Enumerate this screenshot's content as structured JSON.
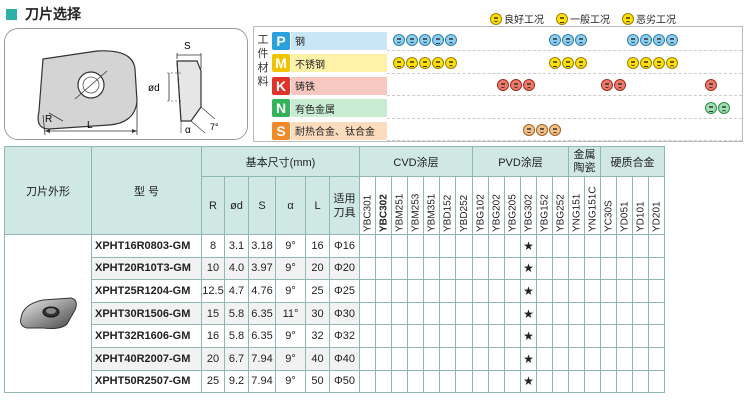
{
  "title": "刀片选择",
  "legend": [
    {
      "label": "良好工况",
      "kind": "good"
    },
    {
      "label": "一般工况",
      "kind": "mid"
    },
    {
      "label": "恶劣工况",
      "kind": "bad"
    }
  ],
  "diagram_labels": {
    "S": "S",
    "phi_d": "ød",
    "R": "R",
    "L": "L",
    "alpha": "α",
    "angle": "7°"
  },
  "wm_label": "工件材料",
  "materials": [
    {
      "code": "P",
      "name": "钢",
      "badge_color": "#2aa0dc",
      "name_bg": "#c8e6f6",
      "face_color": "blue",
      "faces": [
        [
          6,
          "good"
        ],
        [
          19,
          "good"
        ],
        [
          32,
          "good"
        ],
        [
          45,
          "mid"
        ],
        [
          58,
          "bad"
        ],
        [
          162,
          "good"
        ],
        [
          175,
          "good"
        ],
        [
          188,
          "bad"
        ],
        [
          240,
          "good"
        ],
        [
          253,
          "good"
        ],
        [
          266,
          "good"
        ],
        [
          279,
          "bad"
        ]
      ]
    },
    {
      "code": "M",
      "name": "不锈钢",
      "badge_color": "#f2c400",
      "name_bg": "#fff2a8",
      "face_color": "yellow",
      "faces": [
        [
          6,
          "mid"
        ],
        [
          19,
          "mid"
        ],
        [
          32,
          "mid"
        ],
        [
          45,
          "mid"
        ],
        [
          58,
          "bad"
        ],
        [
          162,
          "mid"
        ],
        [
          175,
          "mid"
        ],
        [
          188,
          "bad"
        ],
        [
          240,
          "good"
        ],
        [
          253,
          "mid"
        ],
        [
          266,
          "good"
        ],
        [
          279,
          "bad"
        ]
      ]
    },
    {
      "code": "K",
      "name": "铸铁",
      "badge_color": "#e0342a",
      "name_bg": "#f8c8c0",
      "face_color": "red",
      "faces": [
        [
          110,
          "good"
        ],
        [
          123,
          "good"
        ],
        [
          136,
          "bad"
        ],
        [
          214,
          "good"
        ],
        [
          227,
          "bad"
        ],
        [
          318,
          "good"
        ]
      ]
    },
    {
      "code": "N",
      "name": "有色金属",
      "badge_color": "#34b45a",
      "name_bg": "#c8ecd2",
      "face_color": "green",
      "faces": [
        [
          318,
          "mid"
        ],
        [
          331,
          "bad"
        ]
      ]
    },
    {
      "code": "S",
      "name": "耐热合金、钛合金",
      "badge_color": "#f08a2a",
      "name_bg": "#fbdcbc",
      "face_color": "orange",
      "faces": [
        [
          136,
          "good"
        ],
        [
          149,
          "good"
        ],
        [
          162,
          "bad"
        ]
      ]
    }
  ],
  "table": {
    "h_shape": "刀片外形",
    "h_model": "型 号",
    "h_basic": "基本尺寸(mm)",
    "h_cvd": "CVD涂层",
    "h_pvd": "PVD涂层",
    "h_cermet": "金属陶瓷",
    "h_carbide": "硬质合金",
    "dims": [
      "R",
      "ød",
      "S",
      "α",
      "L",
      "适用刀具"
    ],
    "grades_cvd": [
      "YBC301",
      "YBC302",
      "YBM251",
      "YBM253",
      "YBM351",
      "YBD152",
      "YBD252"
    ],
    "grades_pvd": [
      "YBG102",
      "YBG202",
      "YBG205",
      "YBG302",
      "YBG152",
      "YBG252"
    ],
    "grades_cermet": [
      "YNG151",
      "YNG151C"
    ],
    "grades_carbide": [
      "YC30S",
      "YD051",
      "YD101",
      "YD201"
    ],
    "star": "★",
    "rows": [
      {
        "model": "XPHT16R0803-GM",
        "R": "8",
        "d": "3.1",
        "S": "3.18",
        "a": "9°",
        "L": "16",
        "tool": "Φ16"
      },
      {
        "model": "XPHT20R10T3-GM",
        "R": "10",
        "d": "4.0",
        "S": "3.97",
        "a": "9°",
        "L": "20",
        "tool": "Φ20"
      },
      {
        "model": "XPHT25R1204-GM",
        "R": "12.5",
        "d": "4.7",
        "S": "4.76",
        "a": "9°",
        "L": "25",
        "tool": "Φ25"
      },
      {
        "model": "XPHT30R1506-GM",
        "R": "15",
        "d": "5.8",
        "S": "6.35",
        "a": "11°",
        "L": "30",
        "tool": "Φ30"
      },
      {
        "model": "XPHT32R1606-GM",
        "R": "16",
        "d": "5.8",
        "S": "6.35",
        "a": "9°",
        "L": "32",
        "tool": "Φ32"
      },
      {
        "model": "XPHT40R2007-GM",
        "R": "20",
        "d": "6.7",
        "S": "7.94",
        "a": "9°",
        "L": "40",
        "tool": "Φ40"
      },
      {
        "model": "XPHT50R2507-GM",
        "R": "25",
        "d": "9.2",
        "S": "7.94",
        "a": "9°",
        "L": "50",
        "tool": "Φ50"
      }
    ]
  }
}
